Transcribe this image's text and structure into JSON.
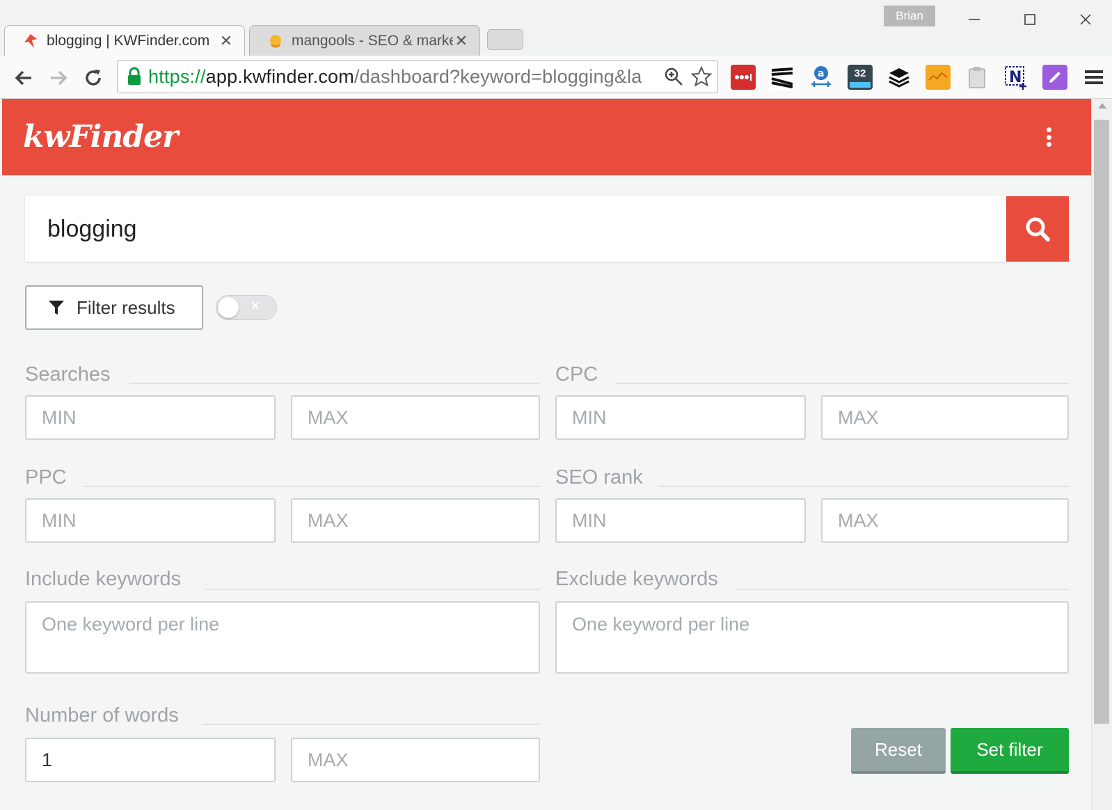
{
  "browser": {
    "user_name": "Brian",
    "tabs": [
      {
        "title": "blogging | KWFinder.com",
        "active": true
      },
      {
        "title": "mangools - SEO & marketing",
        "active": false
      }
    ],
    "url": {
      "scheme": "https://",
      "host": "app.kwfinder.com",
      "path": "/dashboard?keyword=blogging&la"
    },
    "extensions": [
      "lastpass-icon",
      "stripes-icon",
      "amazon-icon",
      "badge-32-icon",
      "buffer-icon",
      "analytics-icon",
      "clipboard-icon",
      "n-plus-icon",
      "pen-icon"
    ],
    "extension_badge": "32",
    "colors": {
      "secure_green": "#0a9b3c"
    }
  },
  "app": {
    "logo_text": "kwFinder",
    "colors": {
      "brand_red": "#e84c3d",
      "reset_gray": "#95a5a6",
      "set_green": "#1faa3f"
    },
    "search": {
      "value": "blogging"
    },
    "filter_button_label": "Filter results",
    "toggle_label": "×",
    "filters": {
      "searches": {
        "label": "Searches",
        "min_placeholder": "MIN",
        "max_placeholder": "MAX"
      },
      "cpc": {
        "label": "CPC",
        "min_placeholder": "MIN",
        "max_placeholder": "MAX"
      },
      "ppc": {
        "label": "PPC",
        "min_placeholder": "MIN",
        "max_placeholder": "MAX"
      },
      "seo_rank": {
        "label": "SEO rank",
        "min_placeholder": "MIN",
        "max_placeholder": "MAX"
      },
      "include_keywords": {
        "label": "Include keywords",
        "placeholder": "One keyword per line"
      },
      "exclude_keywords": {
        "label": "Exclude keywords",
        "placeholder": "One keyword per line"
      },
      "number_of_words": {
        "label": "Number of words",
        "min_value": "1",
        "max_placeholder": "MAX"
      }
    },
    "reset_label": "Reset",
    "set_filter_label": "Set filter"
  }
}
